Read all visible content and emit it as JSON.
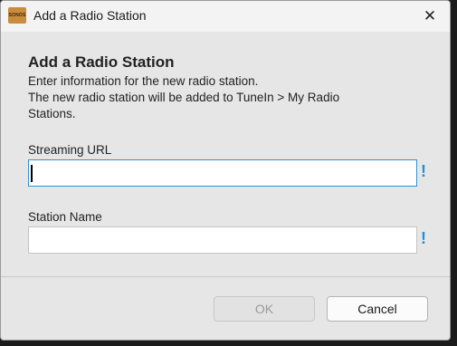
{
  "window": {
    "title": "Add a Radio Station",
    "app_icon_text": "SONOS",
    "close_glyph": "✕"
  },
  "content": {
    "heading": "Add a Radio Station",
    "description_line1": "Enter information for the new radio station.",
    "description_line2": "The new radio station will be added to TuneIn > My Radio",
    "description_line3": "Stations."
  },
  "fields": {
    "streaming_url": {
      "label": "Streaming URL",
      "value": "",
      "required_glyph": "!"
    },
    "station_name": {
      "label": "Station Name",
      "value": "",
      "required_glyph": "!"
    }
  },
  "buttons": {
    "ok": "OK",
    "cancel": "Cancel"
  },
  "colors": {
    "accent": "#1f8fe0",
    "focus_border": "#2f8fd6",
    "dialog_bg": "#e6e6e6"
  }
}
